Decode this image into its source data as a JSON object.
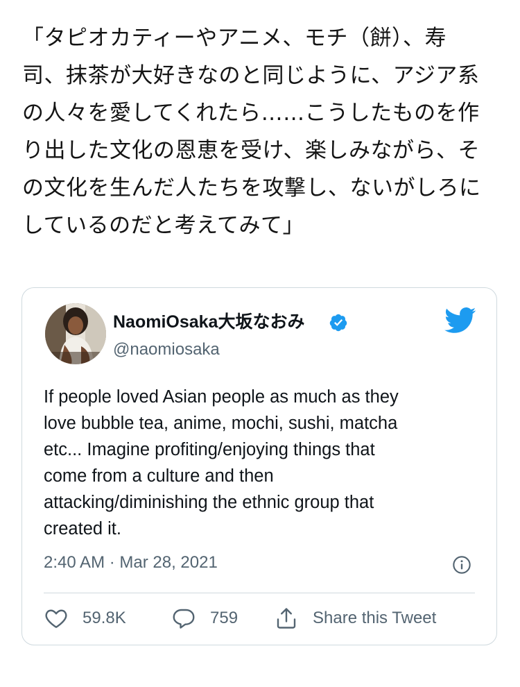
{
  "quote": {
    "lines": [
      "「タピオカティーやアニメ、モチ（餅）、寿",
      "司、抹茶が大好きなのと同じように、アジア系",
      "の人々を愛してくれたら……こうしたものを作",
      "り出した文化の恩恵を受け、楽しみながら、そ",
      "の文化を生んだ人たちを攻撃し、ないがしろに",
      "しているのだと考えてみて」"
    ]
  },
  "tweet": {
    "display_name": "NaomiOsaka大坂なおみ",
    "handle": "@naomiosaka",
    "text_lines": [
      "If people loved Asian people as much as they",
      "love bubble tea, anime, mochi, sushi, matcha",
      "etc... Imagine profiting/enjoying things that",
      "come from a culture and then",
      "attacking/diminishing the ethnic group that",
      "created it."
    ],
    "timestamp": "2:40 AM · Mar 28, 2021",
    "likes": "59.8K",
    "replies": "759",
    "share_label": "Share this Tweet"
  },
  "icons": {
    "verified": "verified-badge-icon",
    "brand": "twitter-bird-icon",
    "info": "info-icon",
    "like": "heart-icon",
    "reply": "reply-bubble-icon",
    "share": "share-icon"
  },
  "colors": {
    "twitter_blue": "#1d9bf0",
    "secondary_text": "#536471",
    "border": "#cfd9de"
  }
}
